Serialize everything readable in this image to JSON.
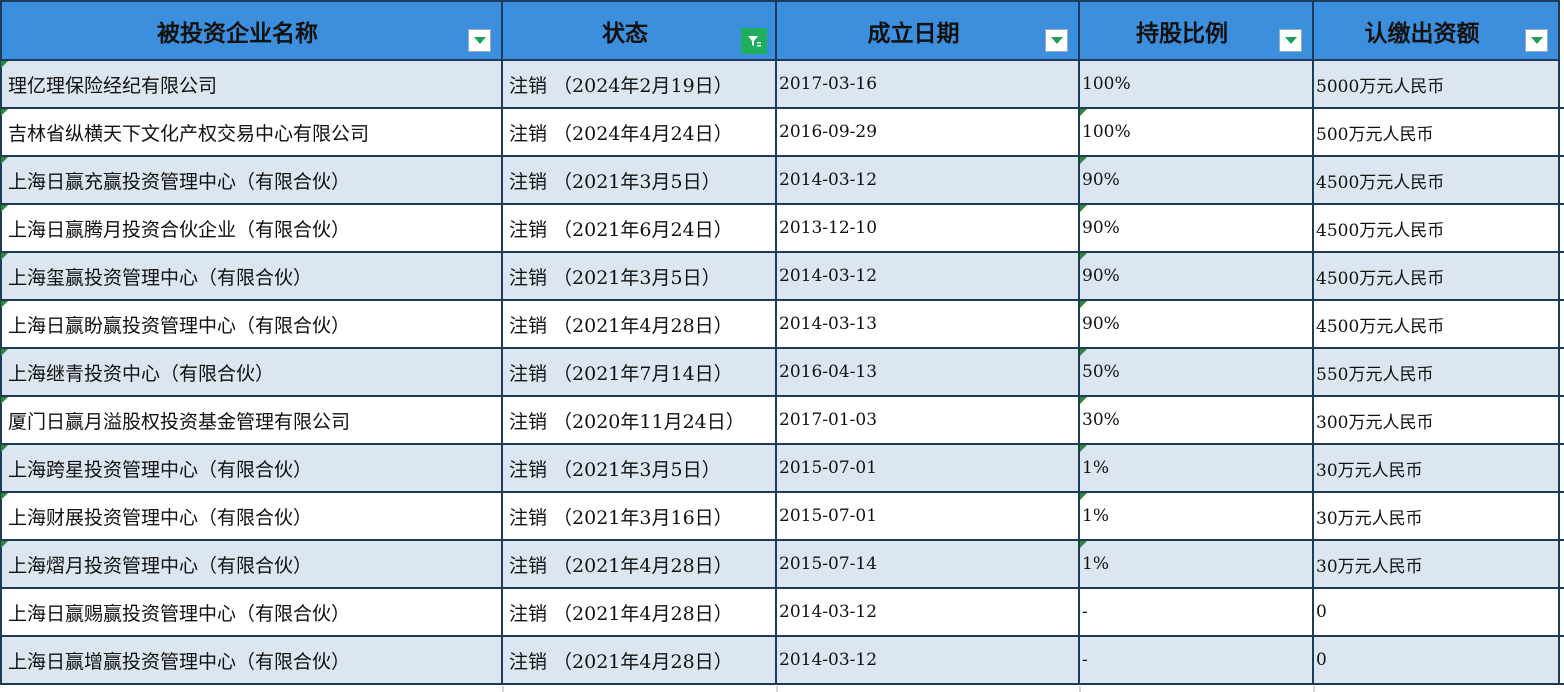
{
  "headers": {
    "name": "被投资企业名称",
    "status": "状态",
    "date": "成立日期",
    "ratio": "持股比例",
    "capital": "认缴出资额"
  },
  "filter_icon": "filter-active-icon",
  "dropdown_icon": "dropdown-arrow-icon",
  "rows": [
    {
      "name": "理亿理保险经纪有限公司",
      "status": "注销 （2024年2月19日）",
      "date": "2017-03-16",
      "ratio": "100%",
      "capital": "5000万元人民币"
    },
    {
      "name": "吉林省纵横天下文化产权交易中心有限公司",
      "status": "注销 （2024年4月24日）",
      "date": "2016-09-29",
      "ratio": "100%",
      "capital": "500万元人民币"
    },
    {
      "name": "上海日赢充赢投资管理中心（有限合伙）",
      "status": "注销 （2021年3月5日）",
      "date": "2014-03-12",
      "ratio": "90%",
      "capital": "4500万元人民币"
    },
    {
      "name": "上海日赢腾月投资合伙企业（有限合伙）",
      "status": "注销 （2021年6月24日）",
      "date": "2013-12-10",
      "ratio": "90%",
      "capital": "4500万元人民币"
    },
    {
      "name": "上海玺赢投资管理中心（有限合伙）",
      "status": "注销 （2021年3月5日）",
      "date": "2014-03-12",
      "ratio": "90%",
      "capital": "4500万元人民币"
    },
    {
      "name": "上海日赢盼赢投资管理中心（有限合伙）",
      "status": "注销 （2021年4月28日）",
      "date": "2014-03-13",
      "ratio": "90%",
      "capital": "4500万元人民币"
    },
    {
      "name": "上海继青投资中心（有限合伙）",
      "status": "注销 （2021年7月14日）",
      "date": "2016-04-13",
      "ratio": "50%",
      "capital": "550万元人民币"
    },
    {
      "name": "厦门日赢月溢股权投资基金管理有限公司",
      "status": "注销 （2020年11月24日）",
      "date": "2017-01-03",
      "ratio": "30%",
      "capital": "300万元人民币"
    },
    {
      "name": "上海跨星投资管理中心（有限合伙）",
      "status": "注销 （2021年3月5日）",
      "date": "2015-07-01",
      "ratio": "1%",
      "capital": "30万元人民币"
    },
    {
      "name": "上海财展投资管理中心（有限合伙）",
      "status": "注销 （2021年3月16日）",
      "date": "2015-07-01",
      "ratio": "1%",
      "capital": "30万元人民币"
    },
    {
      "name": "上海熠月投资管理中心（有限合伙）",
      "status": "注销 （2021年4月28日）",
      "date": "2015-07-14",
      "ratio": "1%",
      "capital": "30万元人民币"
    },
    {
      "name": "上海日赢赐赢投资管理中心（有限合伙）",
      "status": "注销 （2021年4月28日）",
      "date": "2014-03-12",
      "ratio": "-",
      "capital": "0"
    },
    {
      "name": "上海日赢增赢投资管理中心（有限合伙）",
      "status": "注销 （2021年4月28日）",
      "date": "2014-03-12",
      "ratio": "-",
      "capital": "0"
    }
  ],
  "colors": {
    "header_bg": "#3b8fdc",
    "band_bg": "#dce6f1",
    "filter_green": "#1fae5c",
    "border": "#1e3b5a"
  }
}
